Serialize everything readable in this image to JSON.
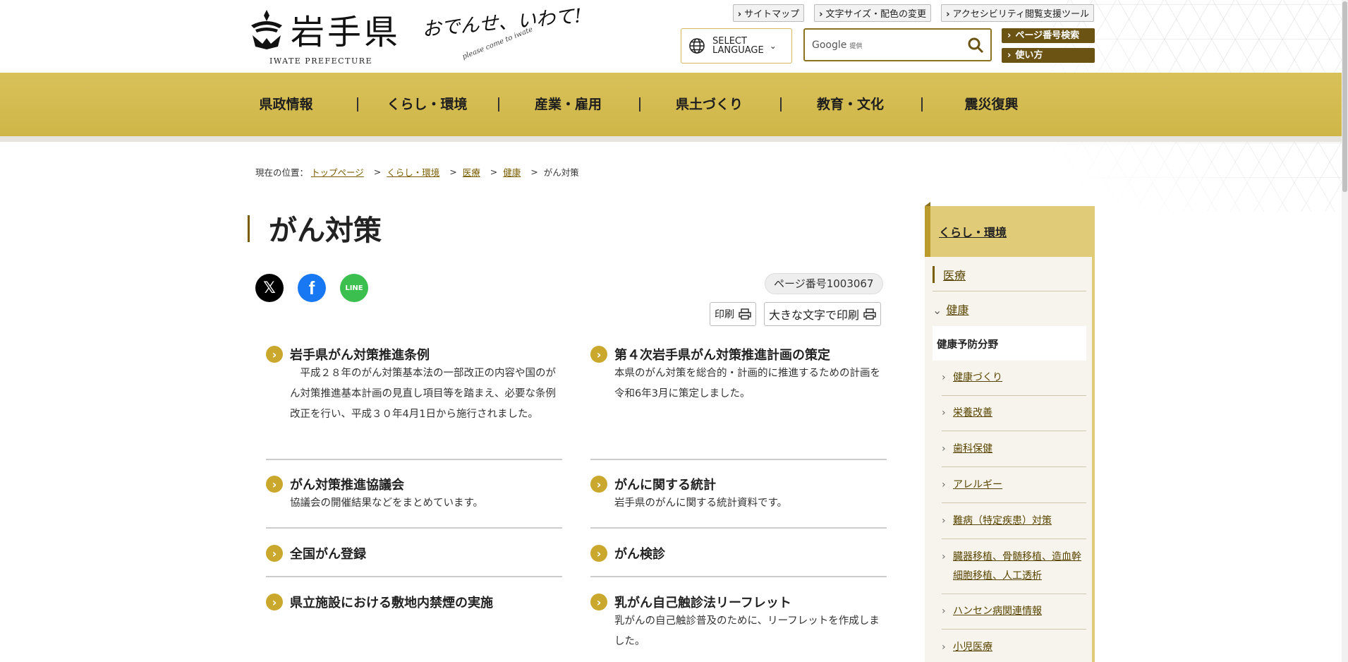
{
  "header": {
    "site_name": "岩手県",
    "site_name_en": "IWATE PREFECTURE",
    "slogan": "おでんせ、いわて!",
    "slogan_sub": "please come to iwate",
    "utility_links": [
      "サイトマップ",
      "文字サイズ・配色の変更",
      "アクセシビリティ閲覧支援ツール"
    ],
    "language": "SELECT\nLANGUAGE",
    "language_l1": "SELECT",
    "language_l2": "LANGUAGE",
    "search_placeholder": "Google",
    "search_provider": "提供",
    "page_number_search": "ページ番号検索",
    "how_to_use": "使い方"
  },
  "nav": [
    "県政情報",
    "くらし・環境",
    "産業・雇用",
    "県土づくり",
    "教育・文化",
    "震災復興"
  ],
  "breadcrumb": {
    "label": "現在の位置：",
    "items": [
      "トップページ",
      "くらし・環境",
      "医療",
      "健康"
    ],
    "current": "がん対策"
  },
  "page": {
    "title": "がん対策",
    "page_number": "ページ番号1003067",
    "print": "印刷",
    "print_large": "大きな文字で印刷"
  },
  "sns": {
    "x": "𝕏",
    "facebook": "f",
    "line": "LINE"
  },
  "items": [
    {
      "title": "岩手県がん対策推進条例",
      "desc": "　平成２８年のがん対策基本法の一部改正の内容や国のがん対策推進基本計画の見直し項目等を踏まえ、必要な条例改正を行い、平成３０年4月1日から施行されました。"
    },
    {
      "title": "第４次岩手県がん対策推進計画の策定",
      "desc": "本県のがん対策を総合的・計画的に推進するための計画を令和6年3月に策定しました。"
    },
    {
      "title": "がん対策推進協議会",
      "desc": "協議会の開催結果などをまとめています。"
    },
    {
      "title": "がんに関する統計",
      "desc": "岩手県のがんに関する統計資料です。"
    },
    {
      "title": "全国がん登録",
      "desc": ""
    },
    {
      "title": "がん検診",
      "desc": ""
    },
    {
      "title": "県立施設における敷地内禁煙の実施",
      "desc": ""
    },
    {
      "title": "乳がん自己触診法リーフレット",
      "desc": "乳がんの自己触診普及のために、リーフレットを作成しました。"
    }
  ],
  "sidebar": {
    "heading": "くらし・環境",
    "top": [
      "医療",
      "健康"
    ],
    "category": "健康予防分野",
    "links": [
      "健康づくり",
      "栄養改善",
      "歯科保健",
      "アレルギー",
      "難病（特定疾患）対策",
      "臓器移植、骨髄移植、造血幹細胞移植、人工透析",
      "ハンセン病関連情報",
      "小児医療"
    ]
  },
  "colors": {
    "accent": "#d9c15a",
    "dark_accent": "#6b5313",
    "arrow": "#c9a82d"
  }
}
